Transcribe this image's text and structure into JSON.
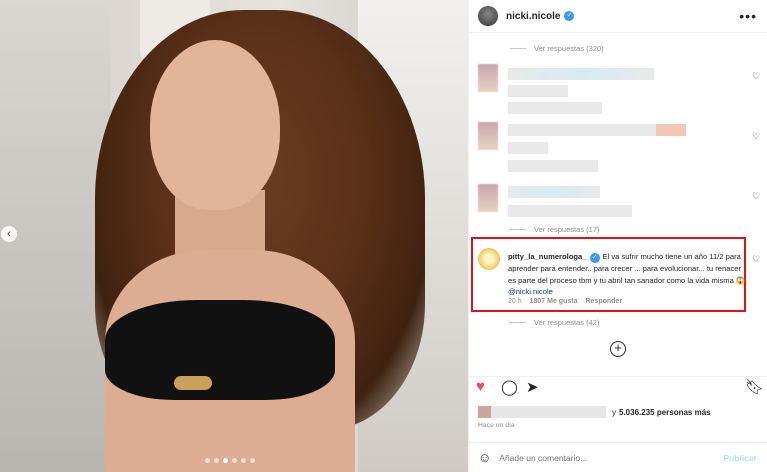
{
  "post": {
    "username": "nicki.nicole",
    "more_icon": "more-horizontal-icon"
  },
  "replies": {
    "top": "Ver respuestas (320)",
    "middle": "Ver respuestas (17)",
    "bottom": "Ver respuestas (42)"
  },
  "highlighted_comment": {
    "username": "pitty_la_numerologa_",
    "text": "El va sufrir mucho tiene un año 11/2 para aprender para entender.. para crecer ... para evolucionar... tu renacer es parte del proceso tbm y tu abril tan sanador como la vida misma 😱",
    "mention": "@nicki.nicole",
    "time": "20 h",
    "likes": "1807 Me gusta",
    "reply": "Responder"
  },
  "likes_line": {
    "prefix": "y",
    "count": "5.036.235 personas más"
  },
  "time_ago": "Hace un día",
  "comment_box": {
    "placeholder": "Añade un comentario...",
    "publish": "Publicar"
  },
  "colors": {
    "highlight_border": "#e0101c",
    "like_red": "#ed4956",
    "mention_blue": "#00376b"
  }
}
